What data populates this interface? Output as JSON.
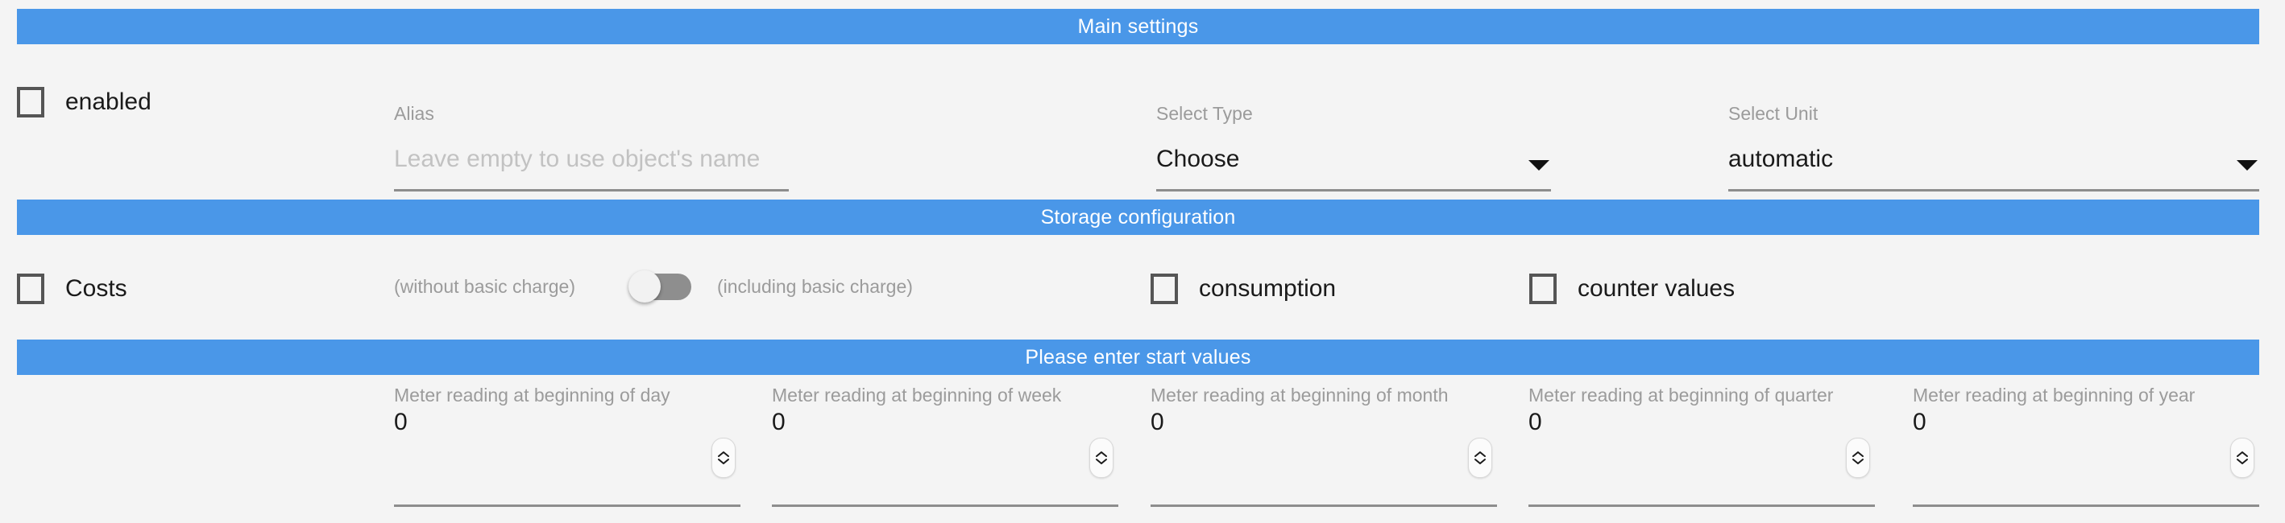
{
  "theme": {
    "accent": "#4a97e8",
    "page_bg": "#f4f4f4",
    "label_gray": "#9b9b9b",
    "text_dark": "#1a1a1a",
    "underline": "#8d8d8d",
    "toggle_track": "#8e8e8e"
  },
  "sections": {
    "main": {
      "title": "Main settings",
      "enabled": {
        "label": "enabled",
        "checked": false
      },
      "alias": {
        "label": "Alias",
        "value": "",
        "placeholder": "Leave empty to use object's name"
      },
      "select_type": {
        "label": "Select Type",
        "value": "Choose"
      },
      "select_unit": {
        "label": "Select Unit",
        "value": "automatic"
      }
    },
    "storage": {
      "title": "Storage configuration",
      "costs": {
        "label": "Costs",
        "checked": false
      },
      "toggle": {
        "left_label": "(without basic charge)",
        "right_label": "(including basic charge)",
        "on": false
      },
      "consumption": {
        "label": "consumption",
        "checked": false
      },
      "counter_values": {
        "label": "counter values",
        "checked": false
      }
    },
    "start_values": {
      "title": "Please enter start values",
      "fields": [
        {
          "label": "Meter reading at beginning of day",
          "value": "0"
        },
        {
          "label": "Meter reading at beginning of week",
          "value": "0"
        },
        {
          "label": "Meter reading at beginning of month",
          "value": "0"
        },
        {
          "label": "Meter reading at beginning of quarter",
          "value": "0"
        },
        {
          "label": "Meter reading at beginning of year",
          "value": "0"
        }
      ]
    }
  }
}
